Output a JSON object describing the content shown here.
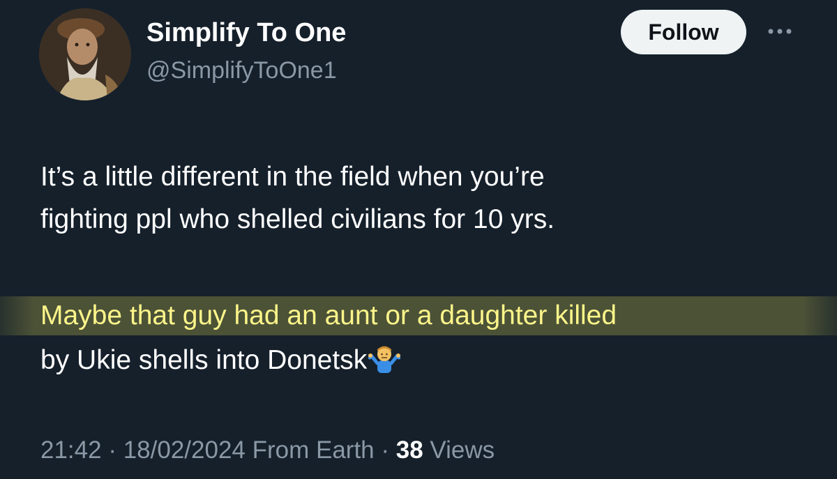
{
  "author": {
    "display_name": "Simplify To One",
    "handle": "@SimplifyToOne1",
    "avatar_icon": "portrait-avatar"
  },
  "actions": {
    "follow_label": "Follow",
    "more_icon": "more-horizontal-icon"
  },
  "tweet": {
    "lines": [
      "It’s a little different in the field when you’re",
      "fighting ppl who shelled civilians for 10 yrs.",
      "Maybe that guy had an aunt or a daughter killed",
      "by Ukie shells into Donetsk"
    ],
    "emoji": "man-shrugging-emoji",
    "highlight_color": "#fdf58a"
  },
  "meta": {
    "time": "21:42",
    "sep1": " · ",
    "date": "18/02/2024",
    "source": " From Earth",
    "sep2": " · ",
    "views_count": "38",
    "views_label": " Views"
  },
  "colors": {
    "background": "#15202b",
    "secondary_text": "#8b98a5",
    "follow_bg": "#eff3f4"
  }
}
